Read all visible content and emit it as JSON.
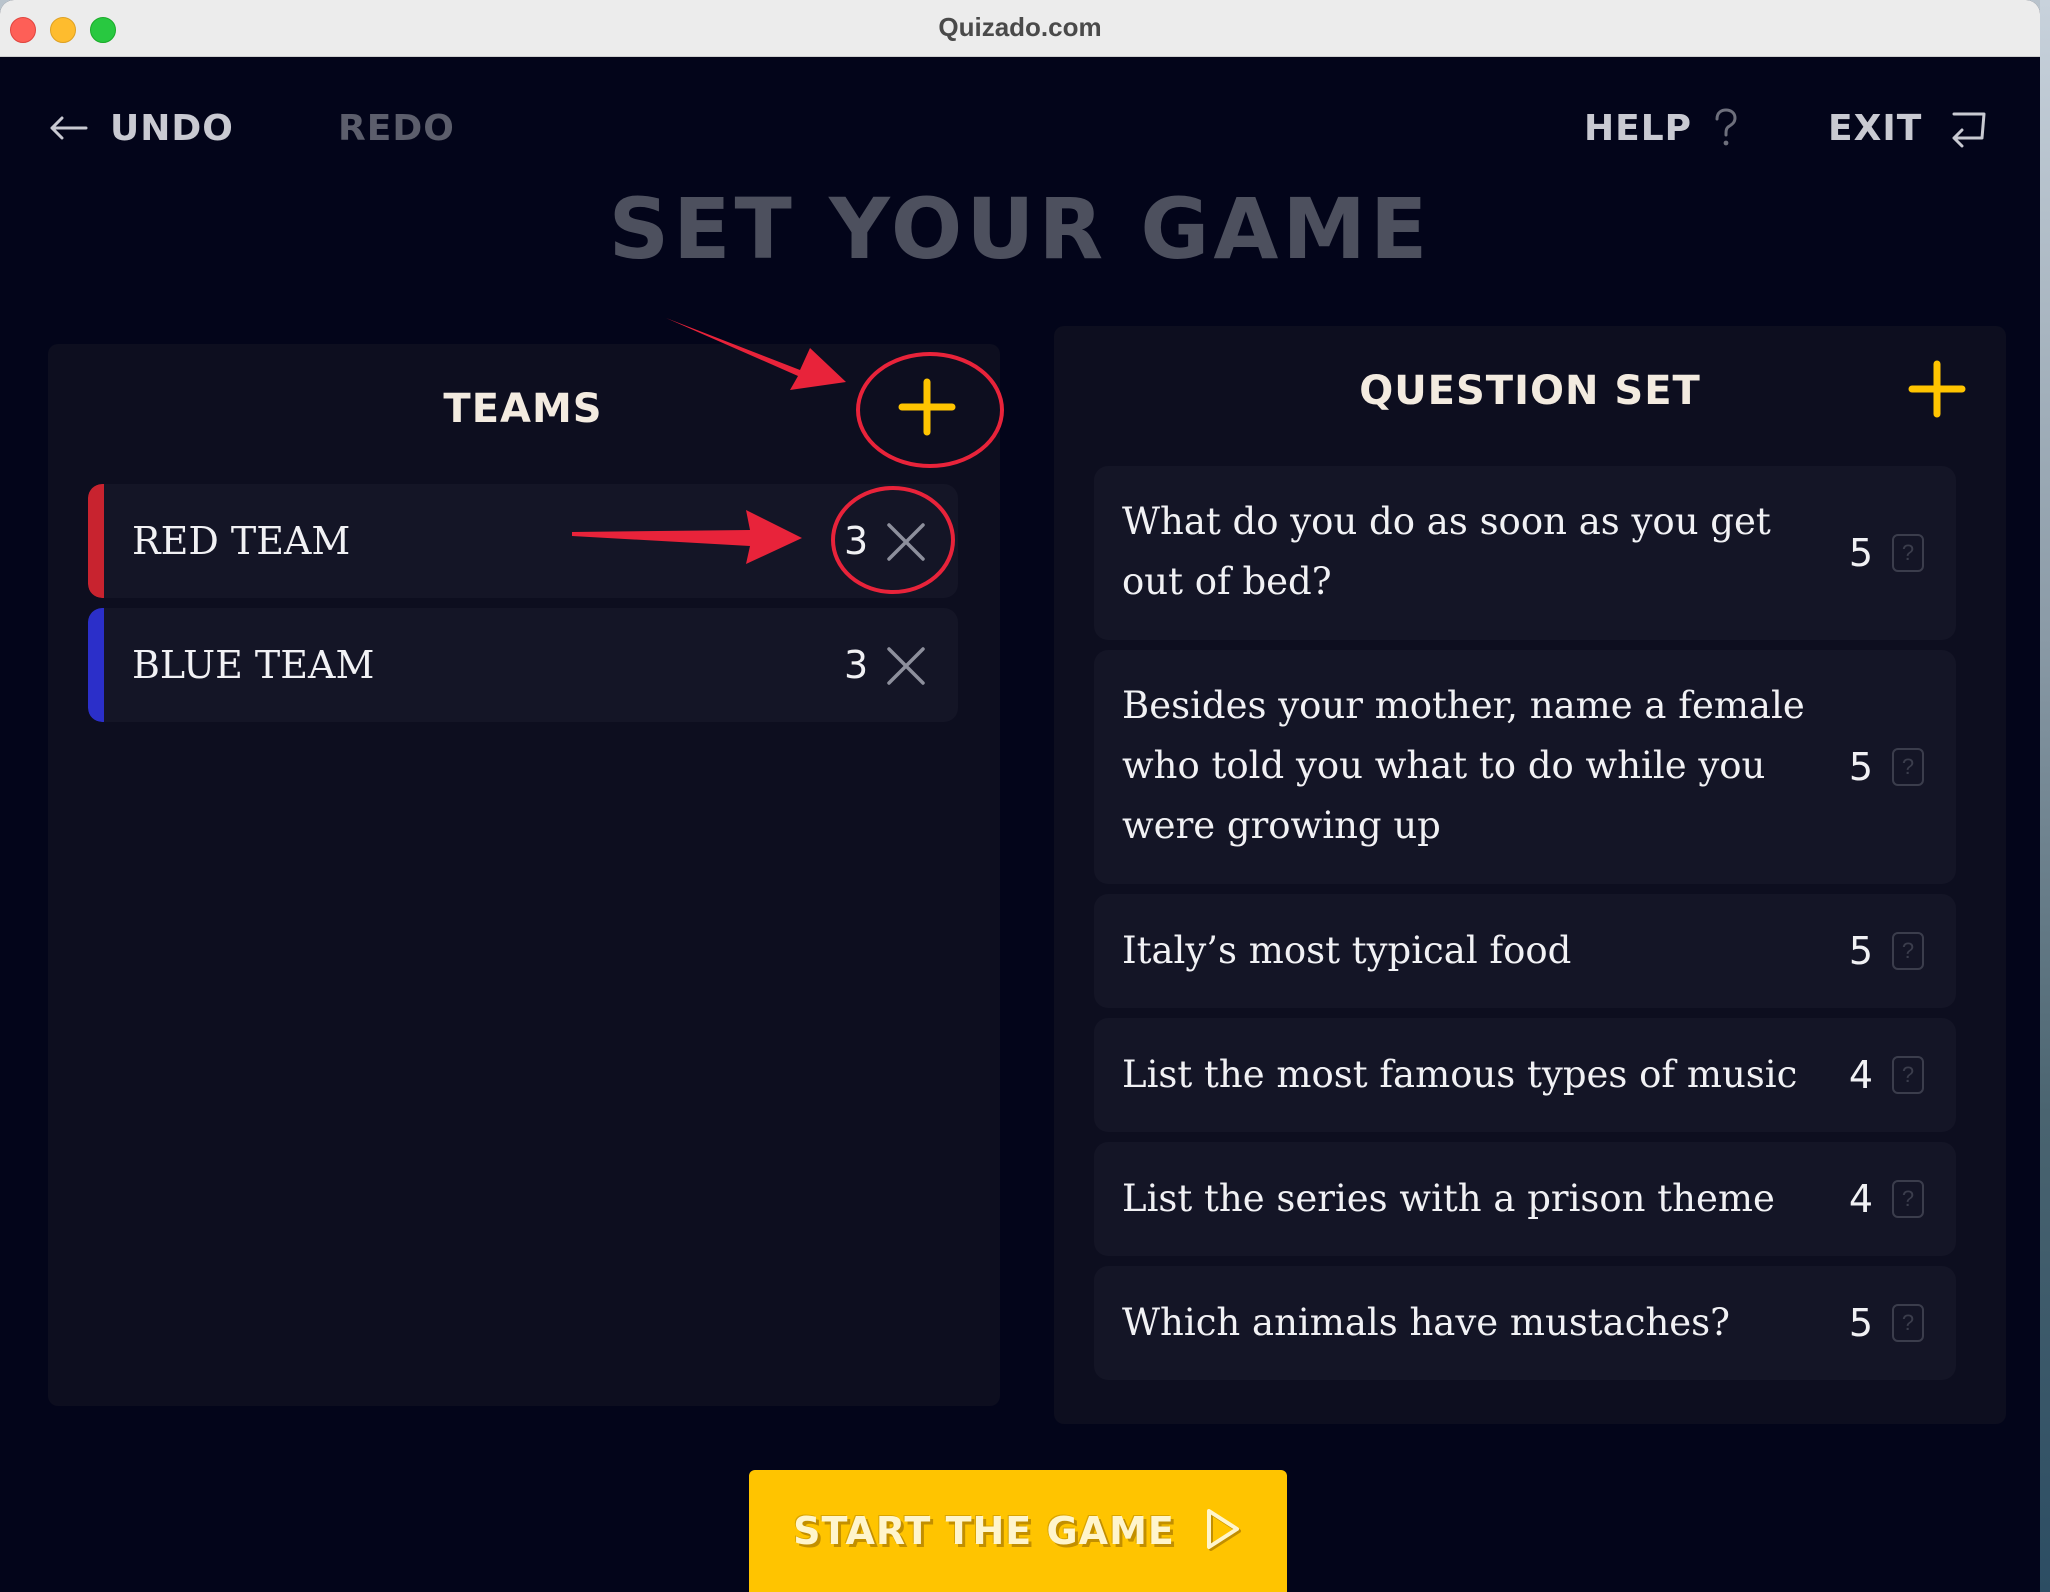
{
  "window": {
    "title": "Quizado.com"
  },
  "toolbar": {
    "undo_label": "UNDO",
    "redo_label": "REDO",
    "help_label": "HELP",
    "exit_label": "EXIT"
  },
  "page": {
    "title": "SET YOUR GAME"
  },
  "teams": {
    "title": "TEAMS",
    "items": [
      {
        "name": "RED TEAM",
        "count": "3",
        "color": "#c8232f"
      },
      {
        "name": "BLUE TEAM",
        "count": "3",
        "color": "#2b2fc9"
      }
    ]
  },
  "question_set": {
    "title": "QUESTION SET",
    "items": [
      {
        "text": "What do you do as soon as you get out of bed?",
        "answers": "5"
      },
      {
        "text": "Besides your mother, name a female who told you what to do while you were growing up",
        "answers": "5"
      },
      {
        "text": "Italy’s most typical food",
        "answers": "5"
      },
      {
        "text": "List the most famous types of music",
        "answers": "4"
      },
      {
        "text": "List the series with a prison theme",
        "answers": "4"
      },
      {
        "text": "Which animals have mustaches?",
        "answers": "5"
      }
    ]
  },
  "start_button": {
    "label": "START THE GAME"
  },
  "colors": {
    "accent": "#ffc400",
    "background": "#03051a",
    "panel": "#0d0e1f",
    "annotation": "#e8233a"
  },
  "icons": {
    "undo": "arrow-left-icon",
    "help": "question-mark-icon",
    "exit": "exit-icon",
    "add": "plus-icon",
    "remove": "close-icon",
    "question_help": "help-box-icon",
    "start": "play-icon"
  }
}
